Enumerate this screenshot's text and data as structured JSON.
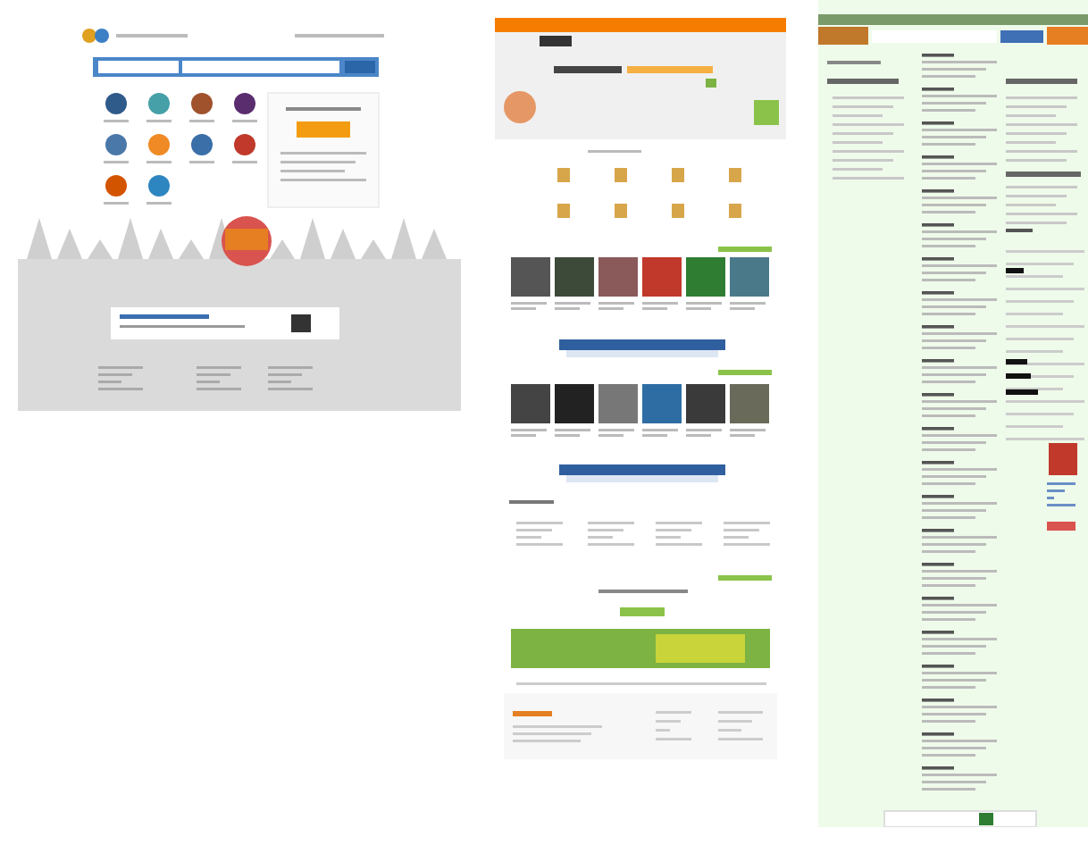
{
  "thumbnails": [
    {
      "kind": "classifieds"
    },
    {
      "kind": "marketplace"
    },
    {
      "kind": "listing"
    }
  ]
}
